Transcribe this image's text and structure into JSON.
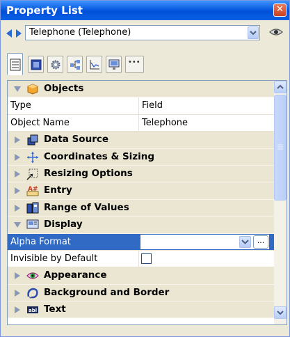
{
  "window": {
    "title": "Property List"
  },
  "selector": {
    "value": "Telephone (Telephone)"
  },
  "tabs": [
    {
      "name": "properties"
    },
    {
      "name": "object"
    },
    {
      "name": "settings"
    },
    {
      "name": "structure"
    },
    {
      "name": "graph"
    },
    {
      "name": "screen"
    },
    {
      "name": "more",
      "label": "•••"
    }
  ],
  "sections": {
    "objects": {
      "label": "Objects",
      "expanded": true
    },
    "data_source": {
      "label": "Data Source",
      "expanded": false
    },
    "coordinates": {
      "label": "Coordinates & Sizing",
      "expanded": false
    },
    "resizing": {
      "label": "Resizing Options",
      "expanded": false
    },
    "entry": {
      "label": "Entry",
      "expanded": false
    },
    "range": {
      "label": "Range of Values",
      "expanded": false
    },
    "display": {
      "label": "Display",
      "expanded": true
    },
    "appearance": {
      "label": "Appearance",
      "expanded": false
    },
    "background": {
      "label": "Background and Border",
      "expanded": false
    },
    "text": {
      "label": "Text",
      "expanded": false
    }
  },
  "properties": {
    "type": {
      "name": "Type",
      "value": "Field"
    },
    "object_name": {
      "name": "Object Name",
      "value": "Telephone"
    },
    "alpha_format": {
      "name": "Alpha Format",
      "value": "",
      "ellipsis": "..."
    },
    "invisible_by_default": {
      "name": "Invisible by Default",
      "checked": false
    }
  },
  "colors": {
    "titlebar": "#0A5BE0",
    "selection": "#316AC5",
    "group_row": "#EAE6D2"
  }
}
